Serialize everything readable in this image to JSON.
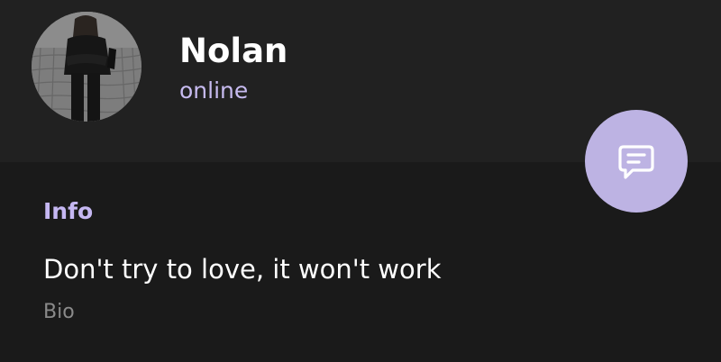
{
  "profile": {
    "name": "Nolan",
    "status": "online",
    "avatar_icon": "user-photo"
  },
  "fab": {
    "icon": "message-icon",
    "color": "#bdb3e3"
  },
  "info": {
    "section_title": "Info",
    "bio_text": "Don't try to love, it won't work",
    "bio_label": "Bio"
  },
  "colors": {
    "header_bg": "#212121",
    "body_bg": "#1a1a1a",
    "accent": "#c7bbf0"
  }
}
